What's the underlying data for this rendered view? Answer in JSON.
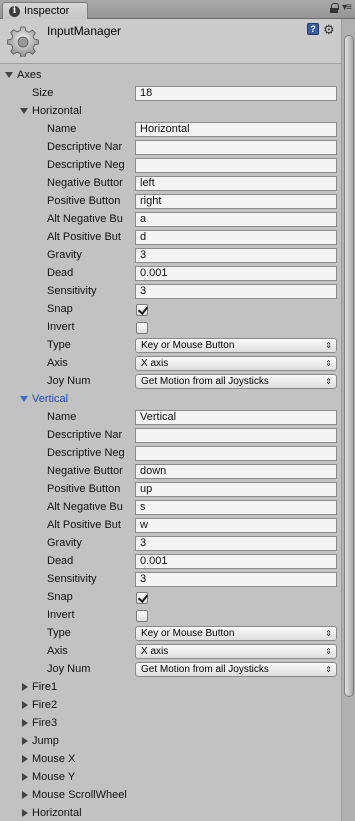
{
  "tab": {
    "title": "Inspector",
    "icon": "info-icon"
  },
  "header": {
    "title": "InputManager"
  },
  "axes": {
    "label": "Axes",
    "size_label": "Size",
    "size_value": "18",
    "entries": [
      {
        "title": "Horizontal",
        "expanded": true,
        "name_label": "Name",
        "name": "Horizontal",
        "desc_label": "Descriptive Nar",
        "desc": "",
        "desc_neg_label": "Descriptive Neg",
        "desc_neg": "",
        "neg_label": "Negative Buttor",
        "neg": "left",
        "pos_label": "Positive Button",
        "pos": "right",
        "alt_neg_label": "Alt Negative Bu",
        "alt_neg": "a",
        "alt_pos_label": "Alt Positive But",
        "alt_pos": "d",
        "gravity_label": "Gravity",
        "gravity": "3",
        "dead_label": "Dead",
        "dead": "0.001",
        "sens_label": "Sensitivity",
        "sens": "3",
        "snap_label": "Snap",
        "snap": true,
        "invert_label": "Invert",
        "invert": false,
        "type_label": "Type",
        "type": "Key or Mouse Button",
        "axis_label": "Axis",
        "axis": "X axis",
        "joy_label": "Joy Num",
        "joy": "Get Motion from all Joysticks"
      },
      {
        "title": "Vertical",
        "expanded": true,
        "name_label": "Name",
        "name": "Vertical",
        "desc_label": "Descriptive Nar",
        "desc": "",
        "desc_neg_label": "Descriptive Neg",
        "desc_neg": "",
        "neg_label": "Negative Buttor",
        "neg": "down",
        "pos_label": "Positive Button",
        "pos": "up",
        "alt_neg_label": "Alt Negative Bu",
        "alt_neg": "s",
        "alt_pos_label": "Alt Positive But",
        "alt_pos": "w",
        "gravity_label": "Gravity",
        "gravity": "3",
        "dead_label": "Dead",
        "dead": "0.001",
        "sens_label": "Sensitivity",
        "sens": "3",
        "snap_label": "Snap",
        "snap": true,
        "invert_label": "Invert",
        "invert": false,
        "type_label": "Type",
        "type": "Key or Mouse Button",
        "axis_label": "Axis",
        "axis": "X axis",
        "joy_label": "Joy Num",
        "joy": "Get Motion from all Joysticks"
      }
    ],
    "collapsed": [
      "Fire1",
      "Fire2",
      "Fire3",
      "Jump",
      "Mouse X",
      "Mouse Y",
      "Mouse ScrollWheel",
      "Horizontal"
    ]
  }
}
